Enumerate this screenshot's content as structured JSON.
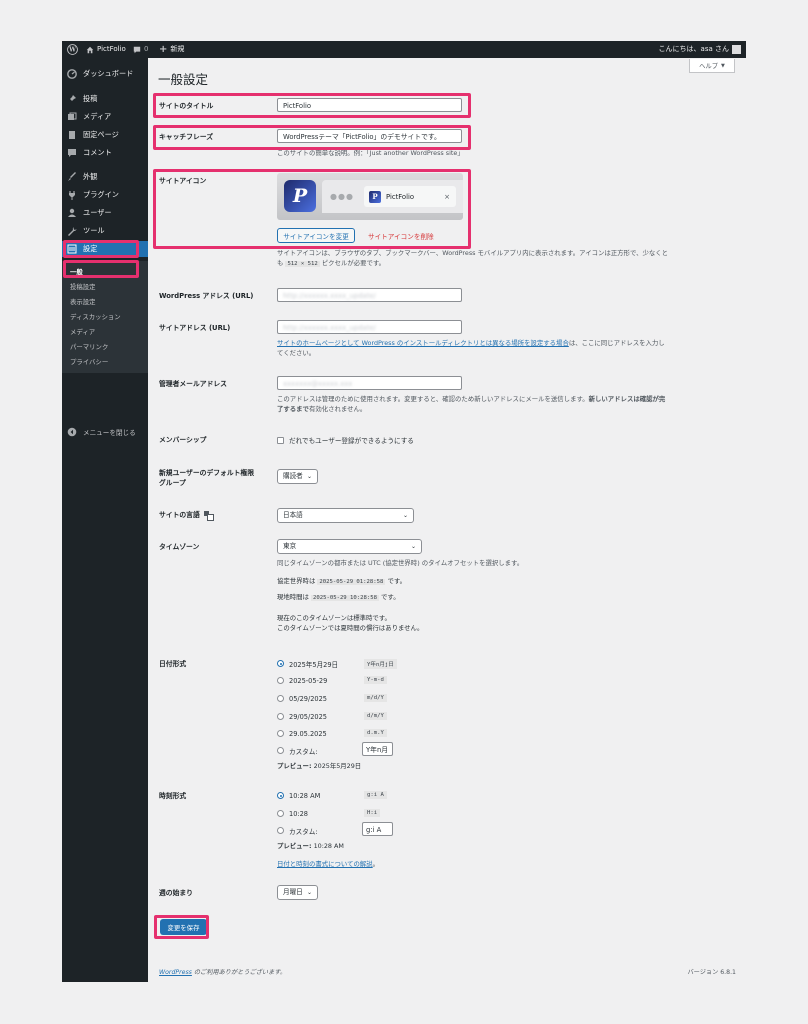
{
  "adminbar": {
    "site_name": "PictFolio",
    "comments_count": "0",
    "new_label": "新規",
    "greeting": "こんにちは、asa さん"
  },
  "sidebar": {
    "dashboard": "ダッシュボード",
    "posts": "投稿",
    "media": "メディア",
    "pages": "固定ページ",
    "comments": "コメント",
    "appearance": "外観",
    "plugins": "プラグイン",
    "users": "ユーザー",
    "tools": "ツール",
    "settings": "設定",
    "submenu": [
      "一般",
      "投稿設定",
      "表示設定",
      "ディスカッション",
      "メディア",
      "パーマリンク",
      "プライバシー"
    ],
    "collapse": "メニューを閉じる"
  },
  "page": {
    "title": "一般設定",
    "help": "ヘルプ"
  },
  "fields": {
    "site_title_label": "サイトのタイトル",
    "site_title_value": "PictFolio",
    "tagline_label": "キャッチフレーズ",
    "tagline_value": "WordPressテーマ「PictFolio」のデモサイトです。",
    "tagline_desc": "このサイトの簡単な説明。例：「Just another WordPress site」",
    "site_icon_label": "サイトアイコン",
    "site_icon_tab_title": "PictFolio",
    "change_icon": "サイトアイコンを変更",
    "remove_icon": "サイトアイコンを削除",
    "site_icon_desc_1": "サイトアイコンは、ブラウザのタブ、ブックマークバー、WordPress モバイルアプリ内に表示されます。アイコンは正方形で、少なくと",
    "site_icon_desc_2a": "も",
    "site_icon_desc_code": "512 × 512",
    "site_icon_desc_2b": "ピクセルが必要です。",
    "wp_url_label": "WordPress アドレス (URL)",
    "wp_url_value": "http://xxxxxx.xxxx_update/",
    "site_url_label": "サイトアドレス (URL)",
    "site_url_value": "http://xxxxxx.xxxx_update/",
    "site_url_link": "サイトのホームページとして WordPress のインストールディレクトリとは異なる場所を設定する場合",
    "site_url_desc_1": "は、ここに同じアドレスを入力し",
    "site_url_desc_2": "てください。",
    "admin_email_label": "管理者メールアドレス",
    "admin_email_value": "xxxxxxx@xxxxx.xxx",
    "admin_email_desc_1a": "このアドレスは管理のために使用されます。変更すると、確認のため新しいアドレスにメールを送信します。",
    "admin_email_desc_1b": "新しいアドレスは確認が完",
    "admin_email_desc_2b": "了するまで",
    "admin_email_desc_2c": "有効化されません。",
    "membership_label": "メンバーシップ",
    "membership_option": "だれでもユーザー登録ができるようにする",
    "default_role_label_1": "新規ユーザーのデフォルト権限",
    "default_role_label_2": "グループ",
    "default_role_value": "購読者",
    "language_label": "サイトの言語",
    "language_value": "日本語",
    "timezone_label": "タイムゾーン",
    "timezone_value": "東京",
    "timezone_desc": "同じタイムゾーンの都市または UTC (協定世界時) のタイムオフセットを選択します。",
    "utc_label": "協定世界時は",
    "utc_value": "2025-05-29 01:28:58",
    "utc_suffix": "です。",
    "local_label": "現地時間は",
    "local_value": "2025-05-29 10:28:58",
    "local_suffix": "です。",
    "tz_note_1": "現在のこのタイムゾーンは標準時です。",
    "tz_note_2": "このタイムゾーンでは夏時間の慣行はありません。",
    "date_format_label": "日付形式",
    "date_options": [
      {
        "label": "2025年5月29日",
        "code": "Y年n月j日"
      },
      {
        "label": "2025-05-29",
        "code": "Y-m-d"
      },
      {
        "label": "05/29/2025",
        "code": "m/d/Y"
      },
      {
        "label": "29/05/2025",
        "code": "d/m/Y"
      },
      {
        "label": "29.05.2025",
        "code": "d.m.Y"
      }
    ],
    "custom_label": "カスタム:",
    "date_custom_value": "Y年n月",
    "preview_label": "プレビュー:",
    "date_preview": "2025年5月29日",
    "time_format_label": "時刻形式",
    "time_options": [
      {
        "label": "10:28 AM",
        "code": "g:i A"
      },
      {
        "label": "10:28",
        "code": "H:i"
      }
    ],
    "time_custom_value": "g:i A",
    "time_preview": "10:28 AM",
    "format_doc_link": "日付と時刻の書式についての解説",
    "format_doc_suffix": "。",
    "week_start_label": "週の始まり",
    "week_start_value": "月曜日"
  },
  "save_button": "変更を保存",
  "footer": {
    "thanks_link": "WordPress",
    "thanks_text": " のご利用ありがとうございます。",
    "version": "バージョン 6.8.1"
  },
  "colors": {
    "adminbar": "#1d2327",
    "accent": "#2271b1",
    "highlight": "#e5306e",
    "danger": "#d63638"
  }
}
